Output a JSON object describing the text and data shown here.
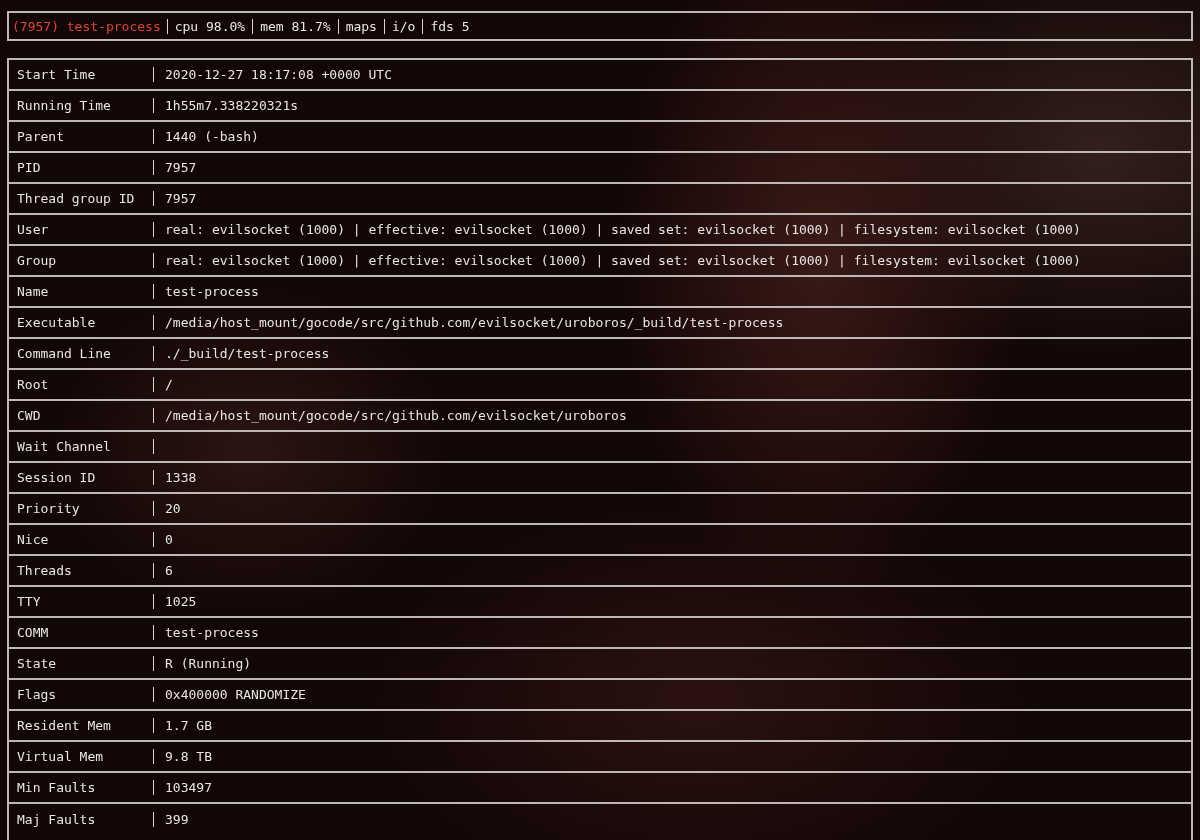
{
  "header": {
    "process": "(7957) test-process",
    "items": [
      "cpu 98.0%",
      "mem 81.7%",
      "maps",
      "i/o",
      "fds 5"
    ]
  },
  "rows": [
    {
      "label": "Start Time",
      "value": "2020-12-27 18:17:08 +0000 UTC"
    },
    {
      "label": "Running Time",
      "value": "1h55m7.338220321s"
    },
    {
      "label": "Parent",
      "value": "1440 (-bash)"
    },
    {
      "label": "PID",
      "value": "7957"
    },
    {
      "label": "Thread group ID",
      "value": "7957"
    },
    {
      "label": "User",
      "value": "real: evilsocket (1000) | effective: evilsocket (1000) | saved set: evilsocket (1000) | filesystem: evilsocket (1000)"
    },
    {
      "label": "Group",
      "value": "real: evilsocket (1000) | effective: evilsocket (1000) | saved set: evilsocket (1000) | filesystem: evilsocket (1000)"
    },
    {
      "label": "Name",
      "value": "test-process"
    },
    {
      "label": "Executable",
      "value": "/media/host_mount/gocode/src/github.com/evilsocket/uroboros/_build/test-process"
    },
    {
      "label": "Command Line",
      "value": "./_build/test-process"
    },
    {
      "label": "Root",
      "value": "/"
    },
    {
      "label": "CWD",
      "value": "/media/host_mount/gocode/src/github.com/evilsocket/uroboros"
    },
    {
      "label": "Wait Channel"
    },
    {
      "label": "Session ID",
      "value": "1338"
    },
    {
      "label": "Priority",
      "value": "20"
    },
    {
      "label": "Nice",
      "value": "0"
    },
    {
      "label": "Threads",
      "value": "6"
    },
    {
      "label": "TTY",
      "value": "1025"
    },
    {
      "label": "COMM",
      "value": "test-process"
    },
    {
      "label": "State",
      "value": "R (Running)"
    },
    {
      "label": "Flags",
      "value": "0x400000 RANDOMIZE"
    },
    {
      "label": "Resident Mem",
      "value": "1.7 GB"
    },
    {
      "label": "Virtual Mem",
      "value": "9.8 TB"
    },
    {
      "label": "Min Faults",
      "value": "103497"
    },
    {
      "label": "Maj Faults",
      "value": "399"
    }
  ]
}
